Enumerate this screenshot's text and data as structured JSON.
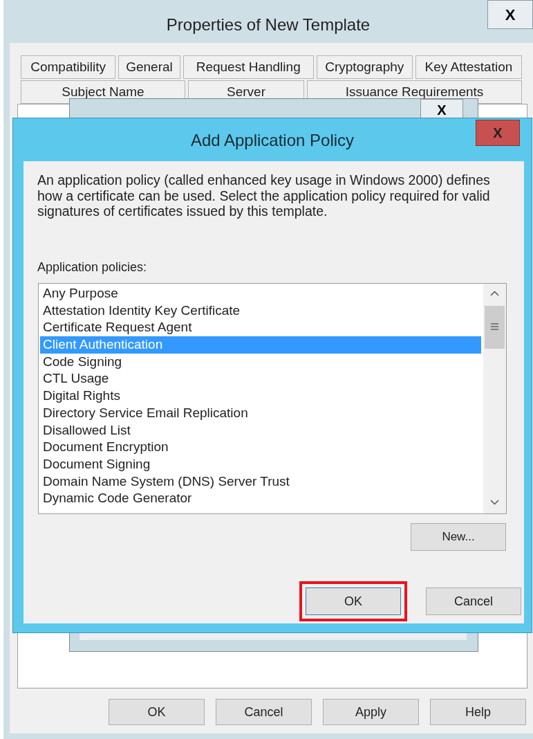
{
  "back_window": {
    "title": "Properties of New Template",
    "tab_rows": [
      [
        {
          "label": "Compatibility",
          "selected": false
        },
        {
          "label": "General",
          "selected": false
        },
        {
          "label": "Request Handling",
          "selected": false
        },
        {
          "label": "Cryptography",
          "selected": false
        },
        {
          "label": "Key Attestation",
          "selected": false
        }
      ],
      [
        {
          "label": "Subject Name",
          "selected": false
        },
        {
          "label": "Server",
          "selected": false
        },
        {
          "label": "Issuance Requirements",
          "selected": false
        }
      ]
    ],
    "buttons": [
      {
        "label": "OK"
      },
      {
        "label": "Cancel"
      },
      {
        "label": "Apply"
      },
      {
        "label": "Help"
      }
    ]
  },
  "middle_window": {
    "close": "X"
  },
  "dialog": {
    "title": "Add Application Policy",
    "close": "X",
    "description": "An application policy (called enhanced key usage in Windows 2000) defines how a certificate can be used. Select the application policy required for valid signatures of certificates issued by this template.",
    "list_label": "Application policies:",
    "policies": [
      {
        "label": "Any Purpose",
        "selected": false
      },
      {
        "label": "Attestation Identity Key Certificate",
        "selected": false
      },
      {
        "label": "Certificate Request Agent",
        "selected": false
      },
      {
        "label": "Client Authentication",
        "selected": true
      },
      {
        "label": "Code Signing",
        "selected": false
      },
      {
        "label": "CTL Usage",
        "selected": false
      },
      {
        "label": "Digital Rights",
        "selected": false
      },
      {
        "label": "Directory Service Email Replication",
        "selected": false
      },
      {
        "label": "Disallowed List",
        "selected": false
      },
      {
        "label": "Document Encryption",
        "selected": false
      },
      {
        "label": "Document Signing",
        "selected": false
      },
      {
        "label": "Domain Name System (DNS) Server Trust",
        "selected": false
      },
      {
        "label": "Dynamic Code Generator",
        "selected": false
      }
    ],
    "new_button": "New...",
    "buttons": [
      {
        "label": "OK",
        "highlighted": true
      },
      {
        "label": "Cancel",
        "highlighted": false
      }
    ]
  },
  "back_close": "X"
}
